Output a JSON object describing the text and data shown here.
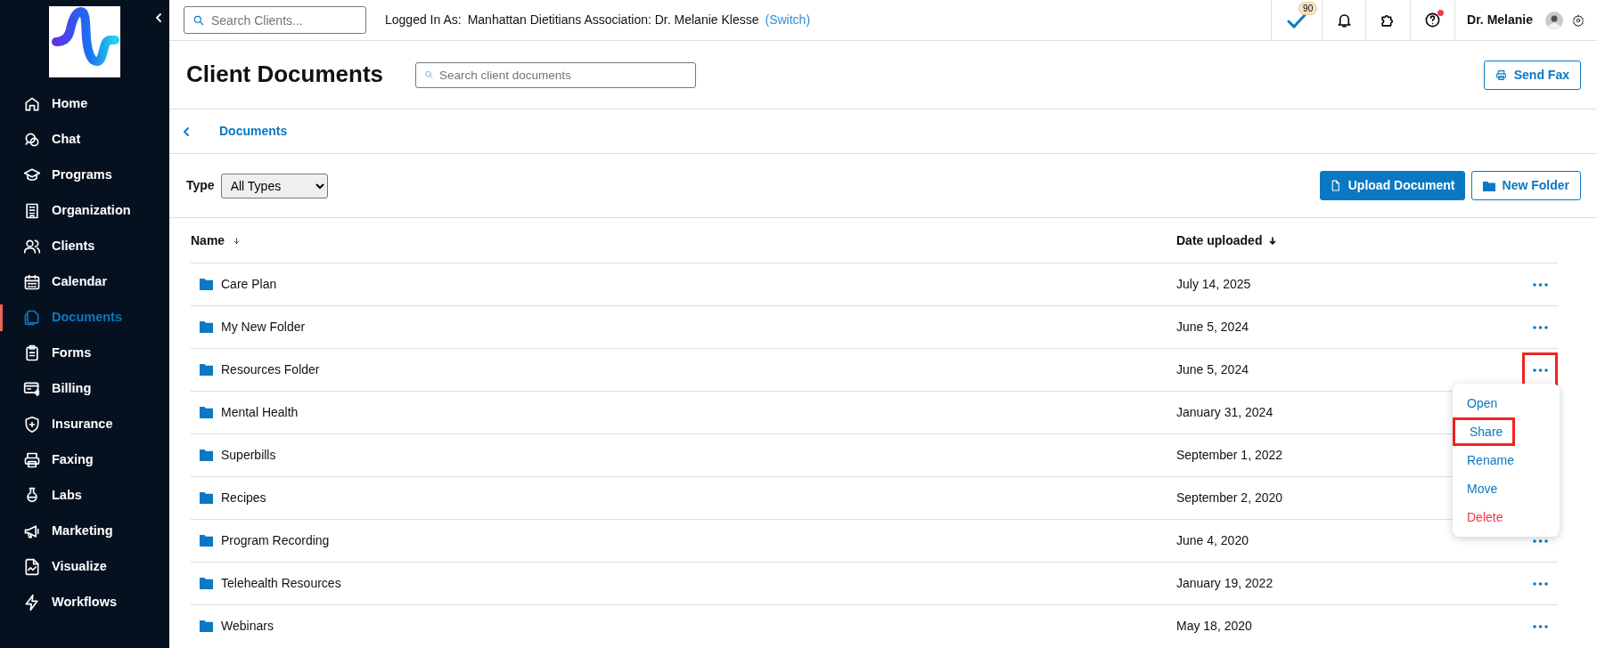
{
  "sidebar": {
    "items": [
      {
        "label": "Home",
        "selected": false
      },
      {
        "label": "Chat",
        "selected": false
      },
      {
        "label": "Programs",
        "selected": false
      },
      {
        "label": "Organization",
        "selected": false
      },
      {
        "label": "Clients",
        "selected": false
      },
      {
        "label": "Calendar",
        "selected": false
      },
      {
        "label": "Documents",
        "selected": true
      },
      {
        "label": "Forms",
        "selected": false
      },
      {
        "label": "Billing",
        "selected": false
      },
      {
        "label": "Insurance",
        "selected": false
      },
      {
        "label": "Faxing",
        "selected": false
      },
      {
        "label": "Labs",
        "selected": false
      },
      {
        "label": "Marketing",
        "selected": false
      },
      {
        "label": "Visualize",
        "selected": false
      },
      {
        "label": "Workflows",
        "selected": false
      }
    ]
  },
  "topbar": {
    "search": {
      "placeholder": "Search Clients..."
    },
    "logged_in_label": "Logged In As:",
    "account": "Manhattan Dietitians Association: Dr. Melanie Klesse",
    "switch_link": "(Switch)",
    "tasks_badge": "90",
    "user_name": "Dr. Melanie"
  },
  "header": {
    "title": "Client Documents",
    "search": {
      "placeholder": "Search client documents"
    },
    "send_fax": "Send Fax"
  },
  "breadcrumb": {
    "current": "Documents"
  },
  "toolbar": {
    "type_label": "Type",
    "type_value": "All Types",
    "upload": "Upload Document",
    "new_folder": "New Folder"
  },
  "table": {
    "columns": [
      "Name",
      "Date uploaded"
    ],
    "rows": [
      {
        "name": "Care Plan",
        "date": "July 14, 2025",
        "more_visible": true,
        "highlighted": false
      },
      {
        "name": "My New Folder",
        "date": "June 5, 2024",
        "more_visible": true,
        "highlighted": false
      },
      {
        "name": "Resources Folder",
        "date": "June 5, 2024",
        "more_visible": true,
        "highlighted": true
      },
      {
        "name": "Mental Health",
        "date": "January 31, 2024"
      },
      {
        "name": "Superbills",
        "date": "September 1, 2022"
      },
      {
        "name": "Recipes",
        "date": "September 2, 2020"
      },
      {
        "name": "Program Recording",
        "date": "June 4, 2020",
        "more_visible": true,
        "highlighted": false
      },
      {
        "name": "Telehealth Resources",
        "date": "January 19, 2022",
        "more_visible": true,
        "highlighted": false
      },
      {
        "name": "Webinars",
        "date": "May 18, 2020",
        "more_visible": true,
        "highlighted": false
      }
    ]
  },
  "context_menu": {
    "items": [
      {
        "label": "Open",
        "kind": "normal",
        "highlighted": false
      },
      {
        "label": "Share",
        "kind": "normal",
        "highlighted": true
      },
      {
        "label": "Rename",
        "kind": "normal",
        "highlighted": false
      },
      {
        "label": "Move",
        "kind": "normal",
        "highlighted": false
      },
      {
        "label": "Delete",
        "kind": "danger",
        "highlighted": false
      }
    ]
  }
}
